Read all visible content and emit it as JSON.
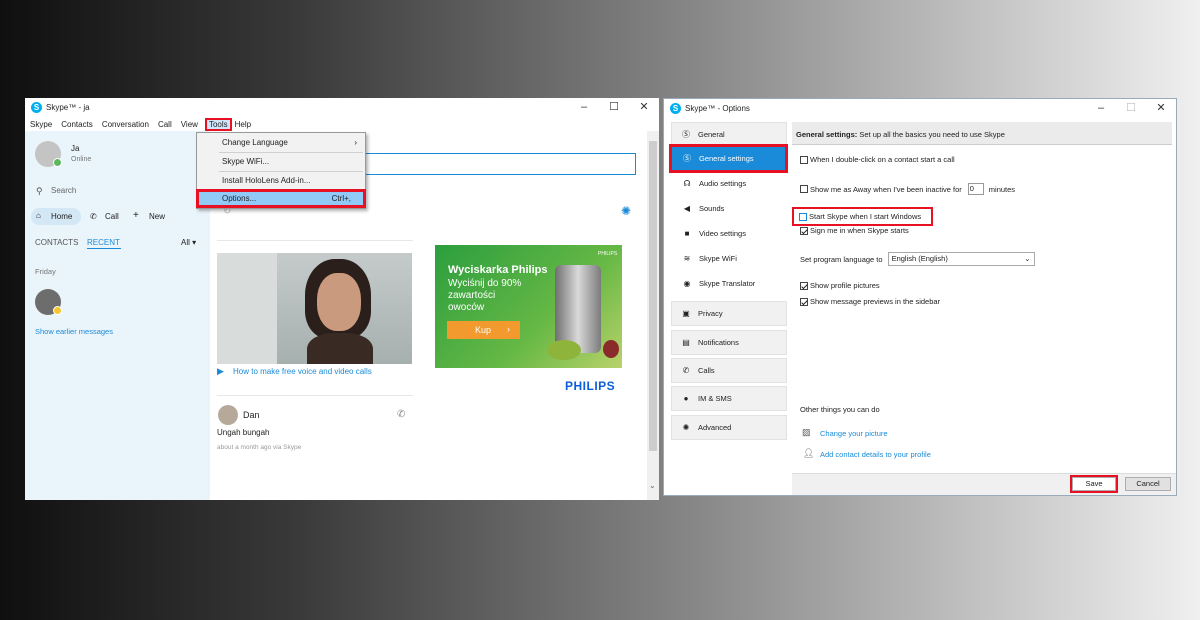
{
  "skype_window": {
    "title": "Skype™ - ja",
    "menu": [
      "Skype",
      "Contacts",
      "Conversation",
      "Call",
      "View",
      "Tools",
      "Help"
    ],
    "user": {
      "name": "Ja",
      "status": "Online"
    },
    "search_placeholder": "Search",
    "nav": {
      "home": "Home",
      "call": "Call",
      "new": "New"
    },
    "tabs": {
      "contacts": "CONTACTS",
      "recent": "RECENT",
      "filter": "All"
    },
    "day_label": "Friday",
    "show_earlier": "Show earlier messages",
    "tools_menu": [
      "Change Language",
      "Skype WiFi...",
      "Install HoloLens Add-in...",
      "Options..."
    ],
    "options_shortcut": "Ctrl+,",
    "video_link": "How to make free voice and video calls",
    "ad": {
      "title": "Wyciskarka Philips",
      "line1": "Wyciśnij do 90%",
      "line2": "zawartości",
      "line3": "owoców",
      "button": "Kup",
      "brand_badge": "PHILIPS",
      "brand": "PHILIPS"
    },
    "post": {
      "author": "Dan",
      "message": "Ungah bungah",
      "meta": "about a month ago via Skype"
    }
  },
  "options_window": {
    "title": "Skype™ - Options",
    "nav": {
      "general": "General",
      "general_settings": "General settings",
      "audio": "Audio settings",
      "sounds": "Sounds",
      "video": "Video settings",
      "wifi": "Skype WiFi",
      "translator": "Skype Translator",
      "privacy": "Privacy",
      "notifications": "Notifications",
      "calls": "Calls",
      "im": "IM & SMS",
      "advanced": "Advanced"
    },
    "header_bold": "General settings:",
    "header_text": " Set up all the basics you need to use Skype",
    "opt_doubleclick": "When I double-click on a contact start a call",
    "opt_away_pre": "Show me as Away when I've been inactive for",
    "away_minutes": "0",
    "opt_away_post": "minutes",
    "opt_start": "Start Skype when I start Windows",
    "opt_signin": "Sign me in when Skype starts",
    "lang_label": "Set program language to",
    "lang_value": "English (English)",
    "opt_pictures": "Show profile pictures",
    "opt_previews": "Show message previews in the sidebar",
    "other_title": "Other things you can do",
    "link_picture": "Change your picture",
    "link_profile": "Add contact details to your profile",
    "save": "Save",
    "cancel": "Cancel"
  },
  "colors": {
    "skype_blue": "#00aff0",
    "highlight_red": "#e81123",
    "link_blue": "#1a8bd8",
    "ad_orange": "#f29a2e"
  }
}
